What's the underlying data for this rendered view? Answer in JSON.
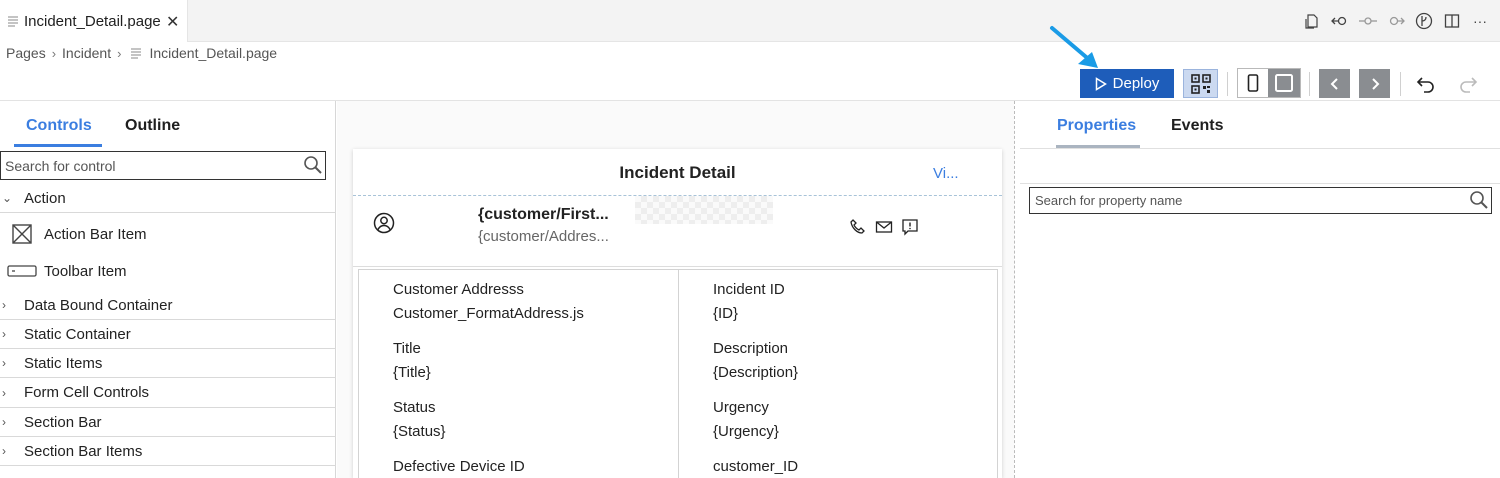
{
  "tab": {
    "title": "Incident_Detail.page"
  },
  "breadcrumb": {
    "items": [
      "Pages",
      "Incident",
      "Incident_Detail.page"
    ]
  },
  "toolbar": {
    "deploy_label": "Deploy"
  },
  "left_panel": {
    "tabs": [
      "Controls",
      "Outline"
    ],
    "search_placeholder": "Search for control",
    "groups": {
      "action": "Action",
      "action_bar_item": "Action Bar Item",
      "toolbar_item": "Toolbar Item",
      "collapsed": [
        "Data Bound Container",
        "Static Container",
        "Static Items",
        "Form Cell Controls",
        "Section Bar",
        "Section Bar Items"
      ]
    }
  },
  "canvas": {
    "page_title": "Incident Detail",
    "header_link": "Vi...",
    "object_header": {
      "title": "{customer/First...",
      "subtitle": "{customer/Addres..."
    },
    "fields": {
      "left": [
        {
          "key": "Customer Addresss",
          "value": "Customer_FormatAddress.js"
        },
        {
          "key": "Title",
          "value": "{Title}"
        },
        {
          "key": "Status",
          "value": "{Status}"
        },
        {
          "key": "Defective Device ID",
          "value": ""
        }
      ],
      "right": [
        {
          "key": "Incident ID",
          "value": "{ID}"
        },
        {
          "key": "Description",
          "value": "{Description}"
        },
        {
          "key": "Urgency",
          "value": "{Urgency}"
        },
        {
          "key": "customer_ID",
          "value": ""
        }
      ]
    }
  },
  "right_panel": {
    "tabs": [
      "Properties",
      "Events"
    ],
    "search_placeholder": "Search for property name"
  },
  "colors": {
    "accent": "#3b7ee0",
    "deploy": "#1e5dba",
    "annotation_arrow": "#1a9be6"
  }
}
